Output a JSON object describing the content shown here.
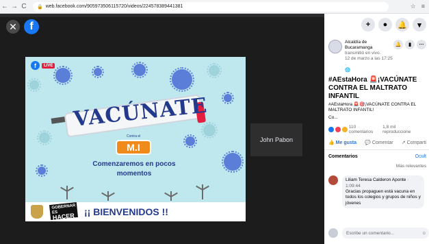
{
  "browser": {
    "back": "←",
    "forward": "→",
    "reload": "C",
    "lock": "🔒",
    "url": "web.facebook.com/905973506115720/videos/224578389441381",
    "star": "☆",
    "menu": "≡"
  },
  "viewer": {
    "close_glyph": "✕",
    "fb_glyph": "f",
    "participant_name": "John Pabon"
  },
  "video": {
    "live_fb": "f",
    "live_label": "LIVE",
    "title_word": "VACÚNATE",
    "contra": "Contra el",
    "badge": "M.I",
    "starting_text_line1": "Comenzaremos en pocos",
    "starting_text_line2": "momentos",
    "gobernar_line1": "GOBERNAR",
    "gobernar_line2": "ES",
    "gobernar_line3": "HACER",
    "welcome": "¡¡ BIENVENIDOS !!"
  },
  "panel": {
    "top_icons": [
      "+",
      "●",
      "🔔",
      "▾"
    ],
    "page_name_line1": "Alcaldía de",
    "page_name_line2": "Bucaramanga",
    "status": "transmitió en vivo.",
    "date": "12 de marzo a las 17:25 ·",
    "privacy": "🌐",
    "post_title": "#AEstaHora 🚨¡VACÚNATE CONTRA EL MALTRATO INFANTIL",
    "post_body": "#AEstaHora 🚨🎯¡VACÚNATE CONTRA EL MALTRATO INFANTIL!",
    "see_more": "Co...",
    "comments_count": "110 comentarios",
    "views": "1,8 mil reproduccione",
    "like": "Me gusta",
    "comment": "Comentar",
    "share": "Comparti",
    "comments_label": "Comentarios",
    "hide_label": "Ocult",
    "relevant": "Más relevantes",
    "comment1_author": "Liliam Teresa Calderon Aponte",
    "comment1_time": "· 1:09:44",
    "comment1_text": "Gracias propaguen está vacuna en todos los colegios y grupos de niños y jóvenes",
    "write_placeholder": "Escribe un comentario...",
    "emoji": "☺"
  },
  "colors": {
    "facebook_blue": "#1877f2",
    "live_red": "#e41e3f",
    "title_blue": "#233a8c",
    "badge_orange": "#f08a1c"
  }
}
